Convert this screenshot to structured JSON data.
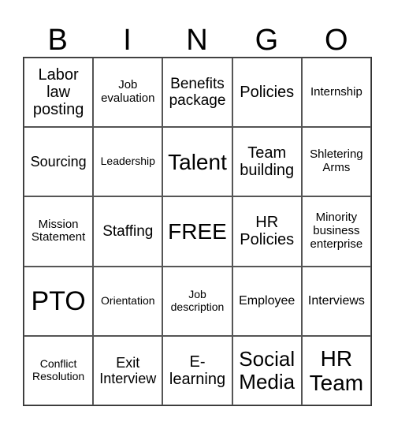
{
  "header": [
    "B",
    "I",
    "N",
    "G",
    "O"
  ],
  "cells": [
    [
      "Labor law posting",
      "Job evaluation",
      "Benefits package",
      "Policies",
      "Internship"
    ],
    [
      "Sourcing",
      "Leadership",
      "Talent",
      "Team building",
      "Shletering Arms"
    ],
    [
      "Mission Statement",
      "Staffing",
      "FREE",
      "HR Policies",
      "Minority business enterprise"
    ],
    [
      "PTO",
      "Orientation",
      "Job description",
      "Employee",
      "Interviews"
    ],
    [
      "Conflict Resolution",
      "Exit Interview",
      "E-learning",
      "Social Media",
      "HR Team"
    ]
  ]
}
